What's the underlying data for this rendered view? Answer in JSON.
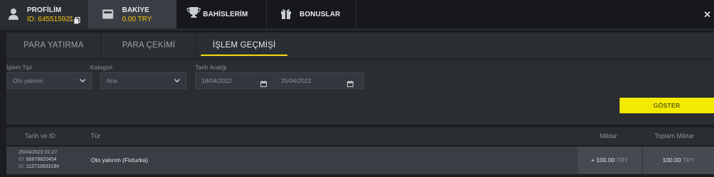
{
  "topnav": {
    "profile": {
      "label": "PROFİLİM",
      "id_text": "ID: 645515921"
    },
    "balance": {
      "label": "BAKİYE",
      "amount": "0.00 TRY"
    },
    "bets": {
      "label": "BAHİSLERİM"
    },
    "bonus": {
      "label": "BONUSLAR"
    },
    "close_icon": "close-icon"
  },
  "subtabs": [
    {
      "label": "PARA YATIRMA",
      "active": false
    },
    {
      "label": "PARA ÇEKİMİ",
      "active": false
    },
    {
      "label": "İŞLEM GEÇMİŞİ",
      "active": true
    }
  ],
  "filters": {
    "type": {
      "label": "İşlem Tipi",
      "value": "Oto yatırım"
    },
    "category": {
      "label": "Kategori",
      "value": "Ana"
    },
    "date_range": {
      "label": "Tarih Aralığı",
      "from": "18/04/2022",
      "to": "25/04/2022"
    },
    "show_button": "GÖSTER"
  },
  "table": {
    "columns": [
      "Tarih ve ID",
      "Tür",
      "Miktar",
      "Toplam Miktar"
    ],
    "rows": [
      {
        "datetime": "25/04/2022 01:27",
        "id1_prefix": "ID:",
        "id1": "66878820454",
        "id2_prefix": "ID:",
        "id2": "112710933184",
        "type": "Oto yatırım (Fixturka)",
        "amount_value": "+ 100.00",
        "amount_currency": "TRY",
        "total_value": "100.00",
        "total_currency": "TRY"
      }
    ]
  },
  "colors": {
    "accent_yellow": "#f2ea00",
    "id_text_orange": "#f2c40c",
    "background": "#1b1d21",
    "panel": "#2a2d32"
  }
}
